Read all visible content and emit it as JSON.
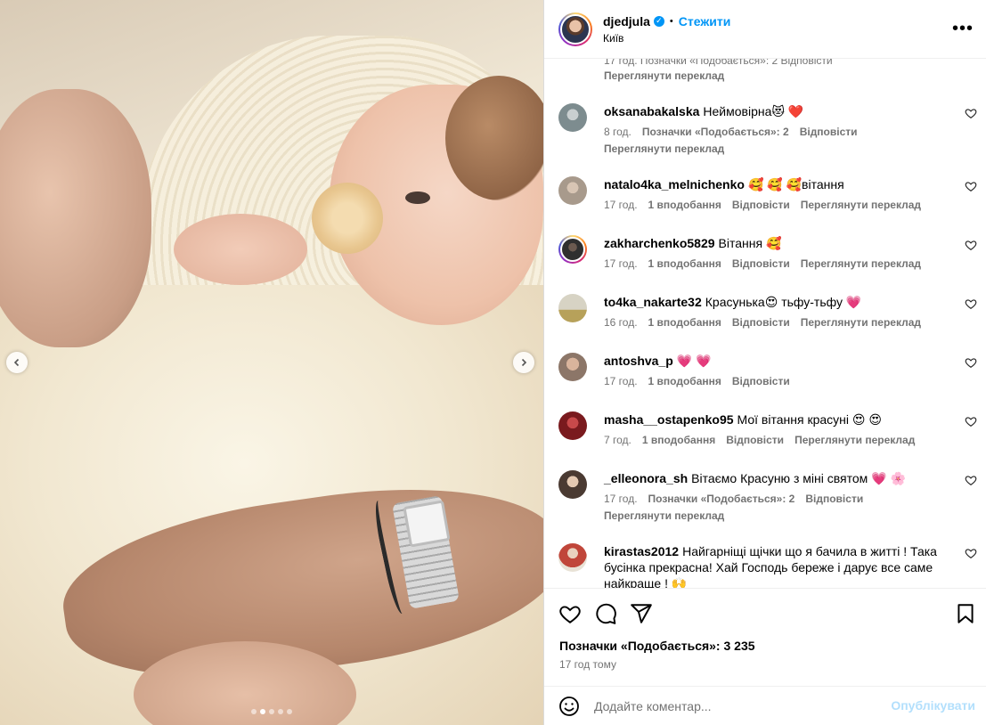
{
  "header": {
    "username": "djedjula",
    "follow_label": "Стежити",
    "location": "Київ",
    "separator": "•"
  },
  "media": {
    "slide_count": 5,
    "active_slide": 2
  },
  "partial_comment": {
    "meta": "17 год.    Позначки «Подобається»: 2    Відповісти",
    "translate": "Переглянути переклад"
  },
  "comments": [
    {
      "username": "oksanabakalska",
      "text": "Неймовірна😻 ❤️",
      "time": "8 год.",
      "likes": "Позначки «Подобається»: 2",
      "reply": "Відповісти",
      "translate": "Переглянути переклад",
      "avatar_color": "#7d8c8f"
    },
    {
      "username": "natalo4ka_melnichenko",
      "text": "🥰 🥰 🥰вітання",
      "time": "17 год.",
      "likes": "1 вподобання",
      "reply": "Відповісти",
      "translate": "Переглянути переклад",
      "avatar_color": "#a89a8c"
    },
    {
      "username": "zakharchenko5829",
      "text": "Вітання 🥰",
      "time": "17 год.",
      "likes": "1 вподобання",
      "reply": "Відповісти",
      "translate": "Переглянути переклад",
      "avatar_color": "#2f2f2f"
    },
    {
      "username": "to4ka_nakarte32",
      "text": "Красунька😍 тьфу-тьфу 💗",
      "time": "16 год.",
      "likes": "1 вподобання",
      "reply": "Відповісти",
      "translate": "Переглянути переклад",
      "avatar_color": "#b7a15a"
    },
    {
      "username": "antoshva_p",
      "text": "💗 💗",
      "time": "17 год.",
      "likes": "1 вподобання",
      "reply": "Відповісти",
      "translate": "",
      "avatar_color": "#8c7668"
    },
    {
      "username": "masha__ostapenko95",
      "text": "Мої вітання красуні 😍 😍",
      "time": "7 год.",
      "likes": "1 вподобання",
      "reply": "Відповісти",
      "translate": "Переглянути переклад",
      "avatar_color": "#7a1a1e"
    },
    {
      "username": "_elleonora_sh",
      "text": "Вітаємо Красуню з міні святом 💗 🌸",
      "time": "17 год.",
      "likes": "Позначки «Подобається»: 2",
      "reply": "Відповісти",
      "translate": "Переглянути переклад",
      "avatar_color": "#4a3a32"
    },
    {
      "username": "kirastas2012",
      "text": "Найгарніщі щічки що я бачила в житті ! Така бусінка прекрасна! Хай Господь береже і дарує все саме найкраще ! 🙌",
      "time": "",
      "likes": "",
      "reply": "",
      "translate": "",
      "avatar_color": "#c0463a"
    }
  ],
  "actions": {
    "likes_label": "Позначки «Подобається»: 3 235",
    "time_ago": "17 год тому"
  },
  "add_comment": {
    "placeholder": "Додайте коментар...",
    "post_label": "Опублікувати"
  },
  "colors": {
    "accent": "#0095f6",
    "post_disabled": "#b2dffc",
    "meta_gray": "#737373"
  }
}
